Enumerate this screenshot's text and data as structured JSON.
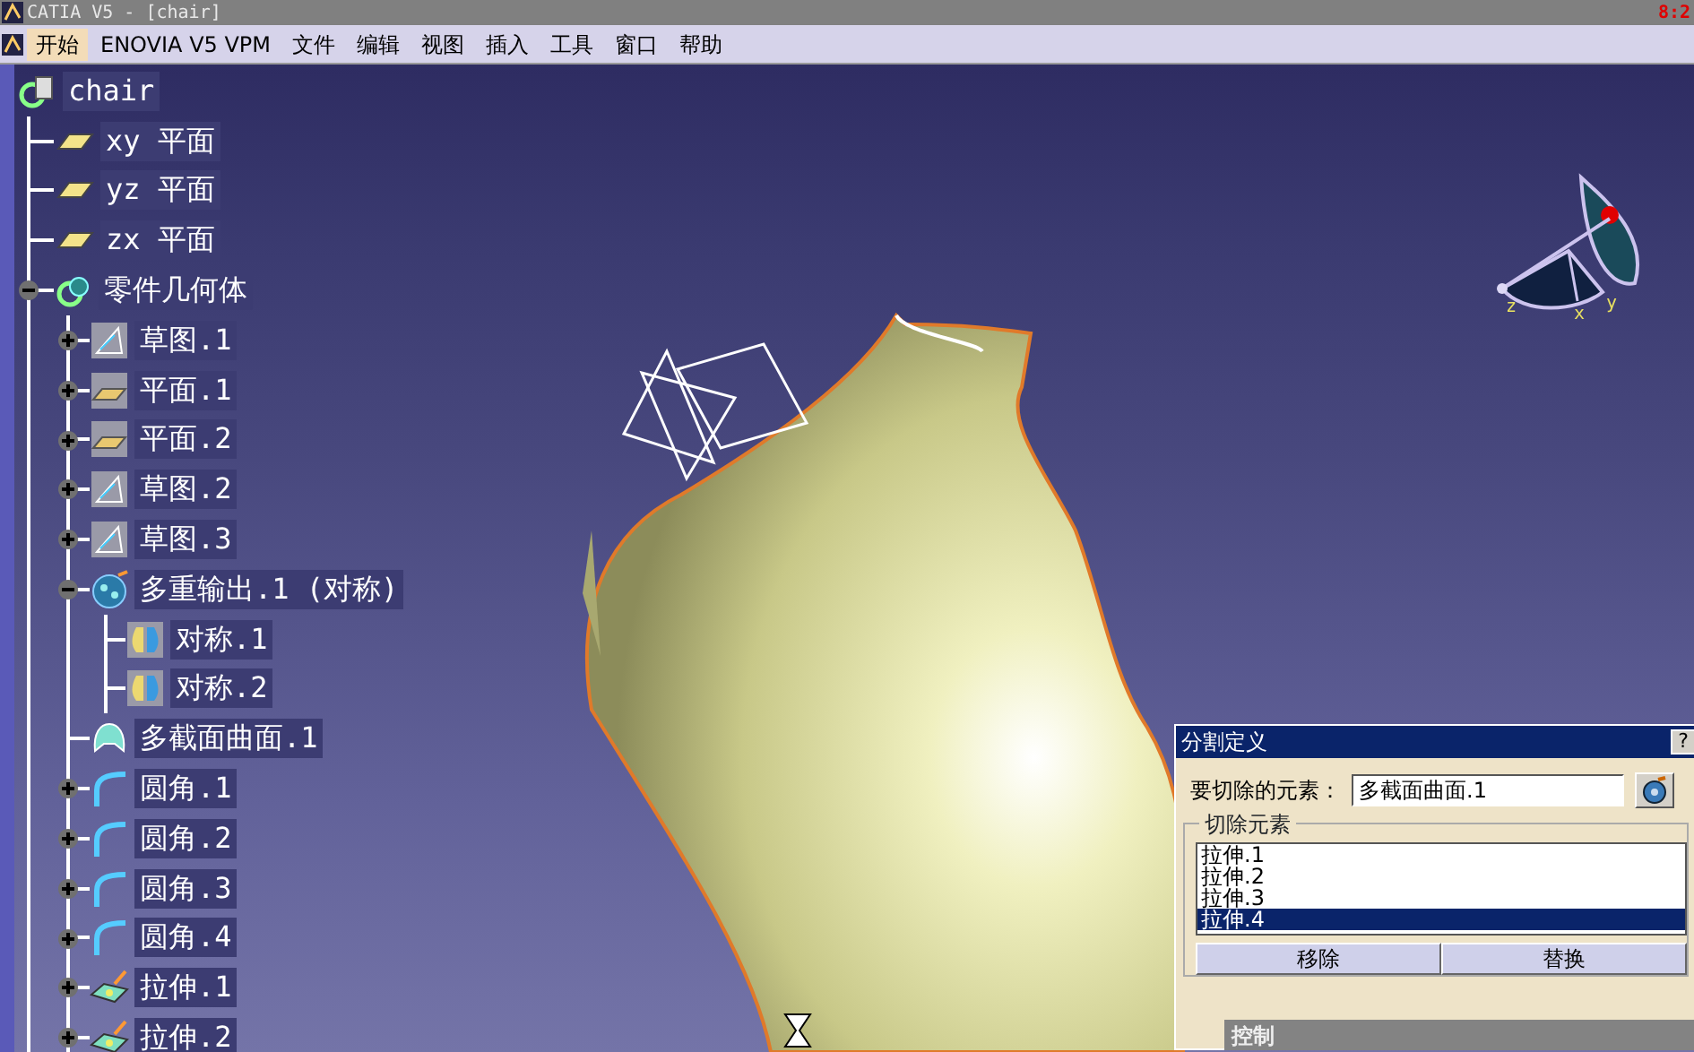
{
  "window": {
    "title": "CATIA V5 - [chair]",
    "clock": "8:2"
  },
  "menu": [
    {
      "label": "开始",
      "selected": true
    },
    {
      "label": "ENOVIA V5 VPM",
      "selected": false
    },
    {
      "label": "文件",
      "selected": false
    },
    {
      "label": "编辑",
      "selected": false
    },
    {
      "label": "视图",
      "selected": false
    },
    {
      "label": "插入",
      "selected": false
    },
    {
      "label": "工具",
      "selected": false
    },
    {
      "label": "窗口",
      "selected": false
    },
    {
      "label": "帮助",
      "selected": false
    }
  ],
  "tree": {
    "label": "chair",
    "kind": "part",
    "children": [
      {
        "label": "xy 平面",
        "kind": "plane"
      },
      {
        "label": "yz 平面",
        "kind": "plane"
      },
      {
        "label": "zx 平面",
        "kind": "plane"
      },
      {
        "label": "零件几何体",
        "kind": "body",
        "expanded": true,
        "children": [
          {
            "label": "草图.1",
            "kind": "sketch",
            "expanded": false
          },
          {
            "label": "平面.1",
            "kind": "plane-feature",
            "expanded": false
          },
          {
            "label": "平面.2",
            "kind": "plane-feature",
            "expanded": false
          },
          {
            "label": "草图.2",
            "kind": "sketch",
            "expanded": false
          },
          {
            "label": "草图.3",
            "kind": "sketch",
            "expanded": false
          },
          {
            "label": "多重输出.1 (对称)",
            "kind": "multi-output",
            "expanded": true,
            "children": [
              {
                "label": "对称.1",
                "kind": "symmetry"
              },
              {
                "label": "对称.2",
                "kind": "symmetry"
              }
            ]
          },
          {
            "label": "多截面曲面.1",
            "kind": "multi-section"
          },
          {
            "label": "圆角.1",
            "kind": "fillet",
            "expanded": false
          },
          {
            "label": "圆角.2",
            "kind": "fillet",
            "expanded": false
          },
          {
            "label": "圆角.3",
            "kind": "fillet",
            "expanded": false
          },
          {
            "label": "圆角.4",
            "kind": "fillet",
            "expanded": false
          },
          {
            "label": "拉伸.1",
            "kind": "extrude",
            "expanded": false
          },
          {
            "label": "拉伸.2",
            "kind": "extrude",
            "expanded": false
          }
        ]
      }
    ]
  },
  "compass": {
    "labels": [
      "z",
      "x",
      "y"
    ]
  },
  "dialog": {
    "title": "分割定义",
    "help": "?",
    "field_label": "要切除的元素：",
    "field_value": "多截面曲面.1",
    "group_label": "切除元素",
    "list": [
      {
        "label": "拉伸.1",
        "selected": false
      },
      {
        "label": "拉伸.2",
        "selected": false
      },
      {
        "label": "拉伸.3",
        "selected": false
      },
      {
        "label": "拉伸.4",
        "selected": true
      }
    ],
    "buttons": [
      "移除",
      "替换"
    ],
    "section": "控制"
  }
}
